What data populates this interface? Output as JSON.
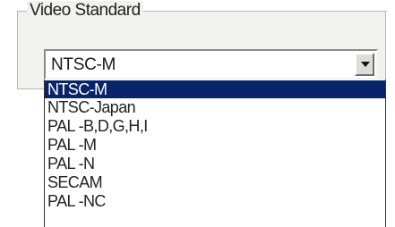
{
  "video_standard": {
    "group_title": "Video Standard",
    "selected_value": "NTSC-M",
    "dropdown_icon": "chevron-down-icon",
    "options": [
      {
        "label": "NTSC-M",
        "selected": true
      },
      {
        "label": "NTSC-Japan",
        "selected": false
      },
      {
        "label": "PAL -B,D,G,H,I",
        "selected": false
      },
      {
        "label": "PAL -M",
        "selected": false
      },
      {
        "label": "PAL -N",
        "selected": false
      },
      {
        "label": "SECAM",
        "selected": false
      },
      {
        "label": "PAL -NC",
        "selected": false
      }
    ]
  },
  "colors": {
    "highlight": "#0a246a",
    "highlight_text": "#ffffff",
    "group_background": "#f1f1ee"
  }
}
